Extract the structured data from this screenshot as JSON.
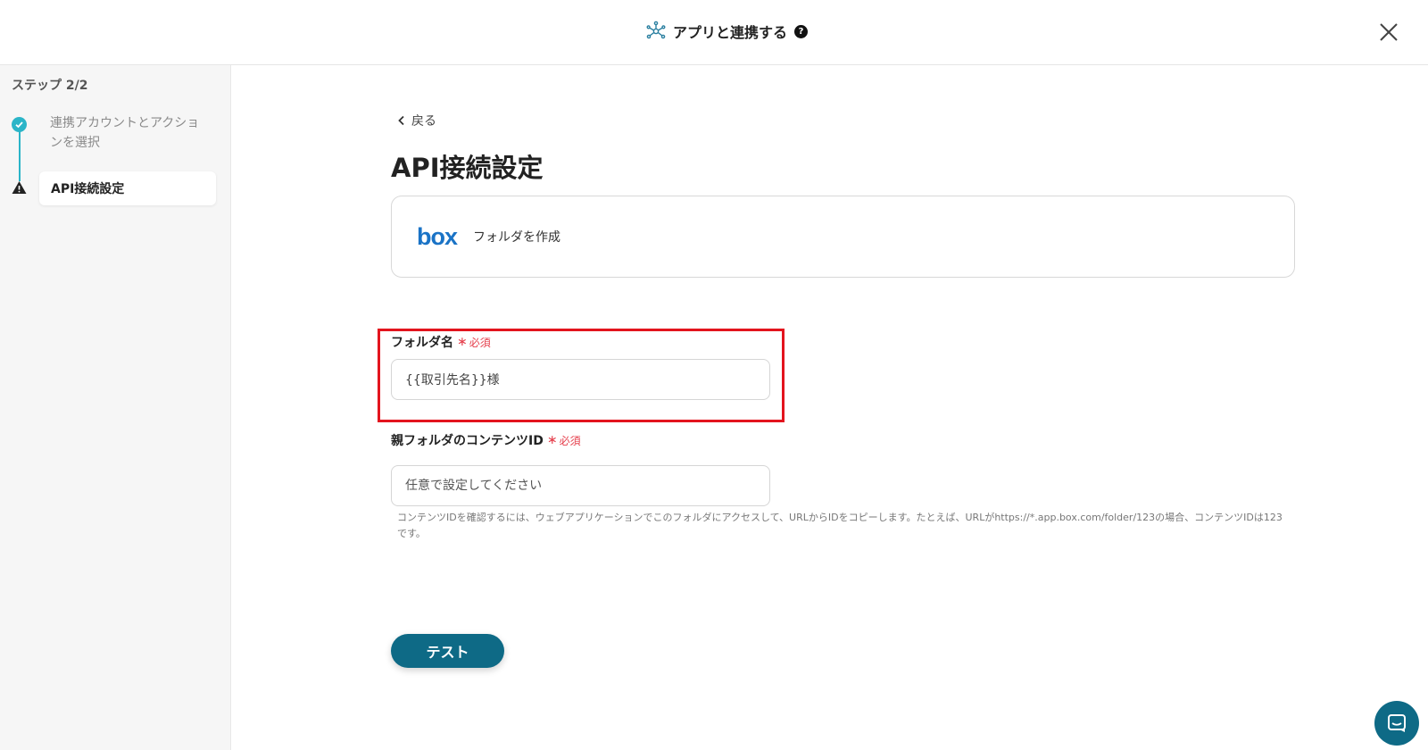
{
  "header": {
    "title": "アプリと連携する",
    "help_glyph": "?"
  },
  "sidebar": {
    "step_label": "ステップ 2/2",
    "steps": [
      {
        "label": "連携アカウントとアクションを選択",
        "status": "done"
      },
      {
        "label": "API接続設定",
        "status": "current"
      }
    ]
  },
  "main": {
    "back_label": "戻る",
    "page_title": "API接続設定",
    "app_card": {
      "logo_text": "box",
      "action": "フォルダを作成"
    },
    "fields": [
      {
        "label": "フォルダ名",
        "required_label": "必須",
        "value": "{{取引先名}}様",
        "placeholder": ""
      },
      {
        "label": "親フォルダのコンテンツID",
        "required_label": "必須",
        "value": "",
        "placeholder": "任意で設定してください",
        "help": "コンテンツIDを確認するには、ウェブアプリケーションでこのフォルダにアクセスして、URLからIDをコピーします。たとえば、URLがhttps://*.app.box.com/folder/123の場合、コンテンツIDは123です。"
      }
    ],
    "test_button": "テスト"
  },
  "colors": {
    "accent": "#2bb5c8",
    "button": "#0e6a86",
    "required": "#e53e4b",
    "highlight": "#e3141e",
    "box_brand": "#1a73c6"
  }
}
